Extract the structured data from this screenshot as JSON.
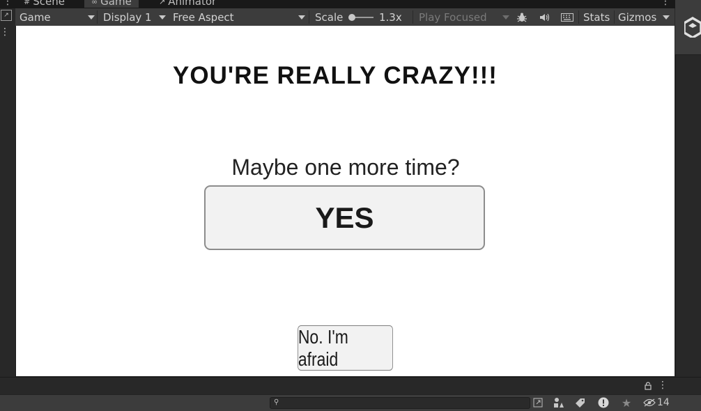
{
  "tabs": [
    {
      "label": "Scene",
      "icon": "scene-grid-icon"
    },
    {
      "label": "Game",
      "icon": "gamepad-icon"
    },
    {
      "label": "Animator",
      "icon": "animator-icon"
    }
  ],
  "toolbar": {
    "mode": "Game",
    "display": "Display 1",
    "aspect": "Free Aspect",
    "scale_label": "Scale",
    "scale_value": "1.3x",
    "play_mode": "Play Focused",
    "stats": "Stats",
    "gizmos": "Gizmos"
  },
  "game": {
    "headline": "YOU'RE REALLY CRAZY!!!",
    "question": "Maybe one more time?",
    "yes_label": "YES",
    "no_label": "No. I'm afraid"
  },
  "bottom": {
    "hidden_count": "14",
    "search_placeholder": ""
  },
  "colors": {
    "editor_bg": "#282828",
    "toolbar_bg": "#3c3c3c",
    "viewport_bg": "#ffffff",
    "button_bg": "#f2f2f2"
  }
}
